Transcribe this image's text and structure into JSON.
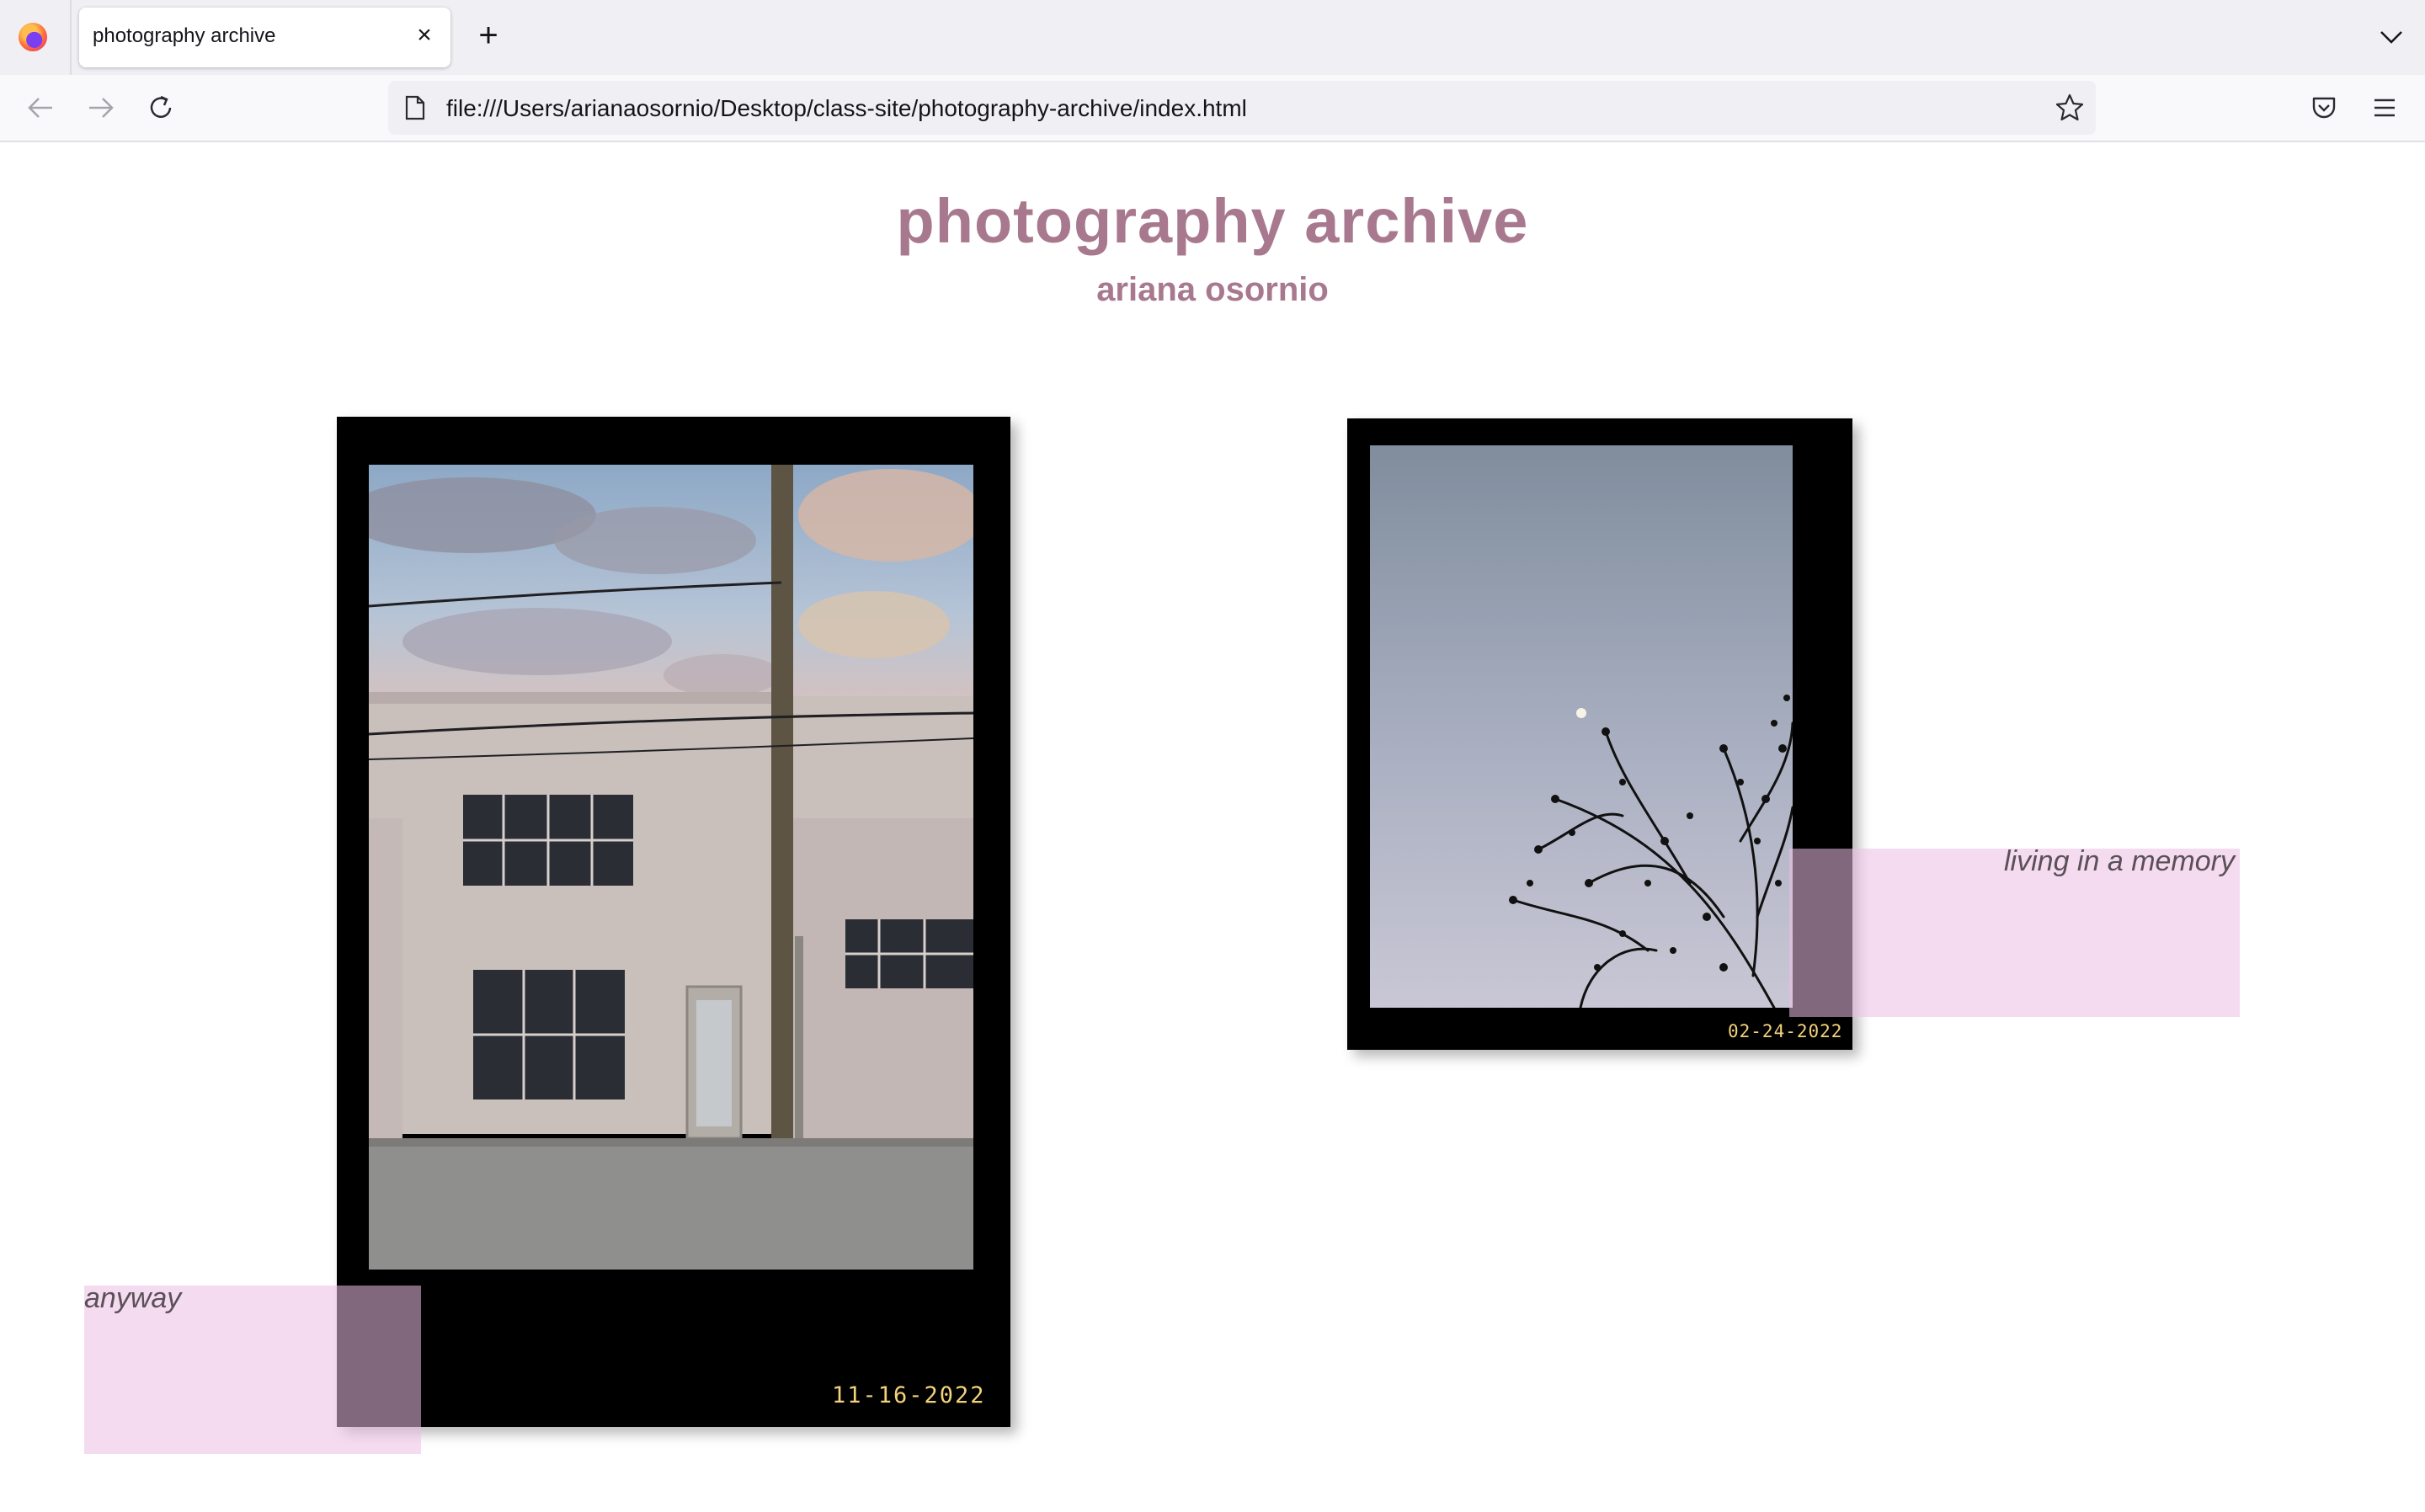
{
  "browser": {
    "tab_title": "photography archive",
    "tab_close": "×",
    "new_tab": "+",
    "url": "file:///Users/arianaosornio/Desktop/class-site/photography-archive/index.html"
  },
  "page": {
    "title": "photography archive",
    "subtitle": "ariana osornio"
  },
  "photos": [
    {
      "date": "11-16-2022",
      "note": "anyway",
      "subject": "white brick building with utility pole under cloudy sky"
    },
    {
      "date": "02-24-2022",
      "note": "living in a memory",
      "subject": "moon in pale sky with silhouetted tree branches"
    }
  ],
  "colors": {
    "heading": "#a8798e",
    "date_text": "#f3d27a",
    "note_box": "#f3d9f2",
    "frame": "#000000"
  },
  "icons": [
    "firefox-logo-icon",
    "close-icon",
    "plus-icon",
    "chevron-down-icon",
    "back-arrow-icon",
    "forward-arrow-icon",
    "reload-icon",
    "page-icon",
    "star-icon",
    "pocket-icon",
    "hamburger-menu-icon"
  ]
}
